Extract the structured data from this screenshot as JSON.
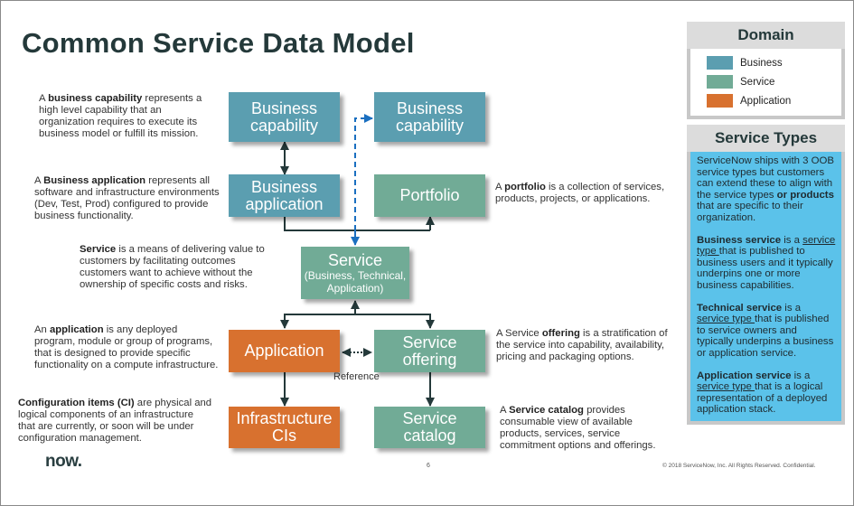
{
  "title": "Common Service Data Model",
  "nodes": {
    "business_capability_left": {
      "label": "Business capability",
      "domain": "Business"
    },
    "business_capability_right": {
      "label": "Business capability",
      "domain": "Business"
    },
    "business_application": {
      "label": "Business application",
      "domain": "Business"
    },
    "portfolio": {
      "label": "Portfolio",
      "domain": "Service"
    },
    "service": {
      "label": "Service",
      "sublabel": "(Business, Technical, Application)",
      "domain": "Service"
    },
    "application": {
      "label": "Application",
      "domain": "Application"
    },
    "service_offering": {
      "label": "Service offering",
      "domain": "Service"
    },
    "infrastructure_cis": {
      "label": "Infrastructure CIs",
      "domain": "Application"
    },
    "service_catalog": {
      "label": "Service catalog",
      "domain": "Service"
    }
  },
  "edges": [
    {
      "from": "business_capability_left",
      "to": "business_application",
      "style": "solid",
      "arrows": "both"
    },
    {
      "from": "business_application",
      "to": "service",
      "style": "solid",
      "arrows": "to-first"
    },
    {
      "from": "portfolio",
      "to": "service",
      "style": "solid",
      "arrows": "to-first"
    },
    {
      "from": "service",
      "to": "business_capability_right",
      "style": "dashed",
      "arrows": "both"
    },
    {
      "from": "service",
      "to": "application",
      "style": "solid",
      "arrows": "both"
    },
    {
      "from": "service",
      "to": "service_offering",
      "style": "solid",
      "arrows": "both"
    },
    {
      "from": "application",
      "to": "service_offering",
      "style": "dotted",
      "arrows": "both",
      "label": "Reference"
    },
    {
      "from": "application",
      "to": "infrastructure_cis",
      "style": "solid",
      "arrows": "to-second"
    },
    {
      "from": "service_offering",
      "to": "service_catalog",
      "style": "solid",
      "arrows": "to-second"
    }
  ],
  "reference_label": "Reference",
  "descriptions": {
    "business_capability": {
      "pre": "A ",
      "bold": "business capability",
      "post": " represents a high level capability that an organization requires to execute its business model or fulfill its mission."
    },
    "business_application": {
      "pre": "A ",
      "bold": "Business application",
      "post": " represents all software and infrastructure environments (Dev, Test, Prod) configured to provide business functionality."
    },
    "service": {
      "pre": "",
      "bold": "Service",
      "post": " is a means of delivering value to customers by facilitating outcomes customers want to achieve without the ownership of specific costs and risks."
    },
    "application": {
      "pre": "An ",
      "bold": "application",
      "post": " is any deployed program, module or group of programs, that is designed to provide specific functionality on a compute infrastructure."
    },
    "configuration_items": {
      "pre": "",
      "bold": "Configuration items (CI)",
      "post": " are physical and logical components of an infrastructure that are currently, or soon will be under configuration management."
    },
    "portfolio": {
      "pre": "A ",
      "bold": "portfolio",
      "post": " is a collection of services, products, projects, or applications."
    },
    "service_offering": {
      "pre": "A Service ",
      "bold": "offering",
      "post": " is a stratification of the service into capability, availability, pricing and packaging options."
    },
    "service_catalog": {
      "pre": "A ",
      "bold": "Service catalog",
      "post": " provides consumable view of available products, services, service commitment options and offerings."
    }
  },
  "legend": {
    "title": "Domain",
    "items": [
      {
        "label": "Business",
        "color": "#5b9eb0"
      },
      {
        "label": "Service",
        "color": "#71ab96"
      },
      {
        "label": "Application",
        "color": "#d8712f"
      }
    ]
  },
  "service_types": {
    "title": "Service Types",
    "intro": {
      "t1": "ServiceNow ships with 3 OOB service types but customers can extend these to align with the service types ",
      "b1": "or products",
      "t2": " that are specific to their organization."
    },
    "business": {
      "bold": "Business service",
      "mid": " is a ",
      "link": "service type ",
      "post": "that is published to business users and it typically underpins one or more business capabilities."
    },
    "technical": {
      "bold": "Technical service",
      "mid": " is a ",
      "link": "service type ",
      "post": "that is published to service owners and typically underpins a business or application service."
    },
    "application": {
      "bold": "Application service",
      "mid": " is a ",
      "link": "service type ",
      "post": "that is a logical representation of a deployed application stack."
    }
  },
  "footer": {
    "logo": "now.",
    "page_number": "6",
    "copyright": "© 2018 ServiceNow, Inc. All Rights Reserved. Confidential."
  },
  "colors": {
    "business": "#5b9eb0",
    "service": "#71ab96",
    "application": "#d8712f",
    "service_types_bg": "#5bc2ea",
    "title": "#24393a"
  }
}
